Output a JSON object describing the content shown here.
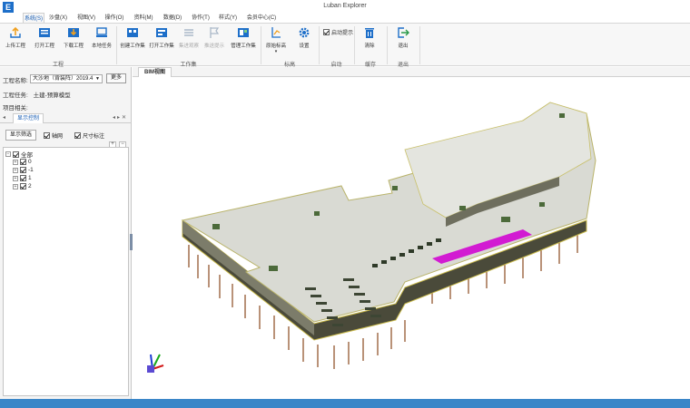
{
  "window": {
    "title": "Luban Explorer",
    "logo": "E"
  },
  "menu": {
    "tabs": [
      "系统(S)",
      "沙盘(X)",
      "视图(V)",
      "操作(O)",
      "资料(M)",
      "数据(D)",
      "协作(T)",
      "样式(Y)",
      "会员中心(C)"
    ],
    "active_index": 0
  },
  "ribbon": {
    "buttons": [
      {
        "label": "上传工程",
        "icon": "upload-project-icon",
        "enabled": true
      },
      {
        "label": "打开工程",
        "icon": "open-project-icon",
        "enabled": true
      },
      {
        "label": "下载工程",
        "icon": "download-project-icon",
        "enabled": true
      },
      {
        "label": "本地任务",
        "icon": "local-task-icon",
        "enabled": true
      },
      {
        "label": "创建工作集",
        "icon": "create-workset-icon",
        "enabled": true
      },
      {
        "label": "打开工作集",
        "icon": "open-workset-icon",
        "enabled": true
      },
      {
        "label": "集进观察",
        "icon": "workset-observe-icon",
        "enabled": false
      },
      {
        "label": "推送提示",
        "icon": "push-flag-icon",
        "enabled": false
      },
      {
        "label": "管理工作集",
        "icon": "manage-workset-icon",
        "enabled": true
      },
      {
        "label": "原始标高",
        "icon": "elevation-icon",
        "enabled": true
      },
      {
        "label": "设置",
        "icon": "gear-icon",
        "enabled": true
      },
      {
        "label": "清除",
        "icon": "trash-icon",
        "enabled": true
      },
      {
        "label": "退出",
        "icon": "exit-icon",
        "enabled": true
      }
    ],
    "groups": [
      "工程",
      "工作集",
      "标高",
      "启动",
      "缓存",
      "退出"
    ],
    "startup_checkbox": {
      "label": "启动提示",
      "checked": true
    }
  },
  "left_panel": {
    "project_name_label": "工程名称:",
    "project_name_value": "大沙地（背装阵）2019.4",
    "more_button": "更多",
    "project_task_label": "工程任务:",
    "project_task_value": "土建-预算模型",
    "project_related_label": "项目相关:",
    "tab_label": "显示控制",
    "filter_button": "显示筛选",
    "options": [
      {
        "label": "轴网",
        "checked": true
      },
      {
        "label": "尺寸标注",
        "checked": true
      }
    ],
    "tree": {
      "root": "全部",
      "children": [
        "0",
        "-1",
        "1",
        "2"
      ]
    }
  },
  "viewport": {
    "tab_label": "BIM视图"
  },
  "colors": {
    "accent": "#1b5fb4",
    "status_bar": "#3a86c8",
    "highlight_magenta": "#d21bd2"
  }
}
